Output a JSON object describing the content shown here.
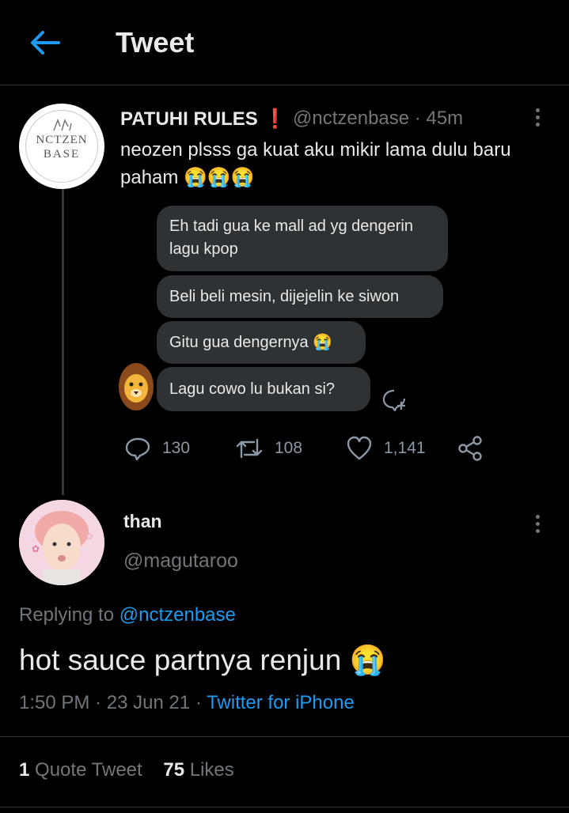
{
  "header": {
    "title": "Tweet",
    "back_icon": "arrow-left-icon",
    "accent": "#1d9bf0"
  },
  "tweet": {
    "author_name": "PATUHI RULES",
    "author_badge": "❗",
    "handle": "@nctzenbase",
    "dot": "·",
    "time": "45m",
    "text": "neozen plsss ga kuat aku mikir lama dulu baru paham 😭😭😭",
    "avatar_brand_line1": "NCTZEN",
    "avatar_brand_line2": "BASE",
    "image_chat": {
      "messages": [
        "Eh tadi gua ke mall ad yg dengerin lagu kpop",
        "Beli beli mesin, dijejelin ke siwon",
        "Gitu gua dengernya 😭",
        "Lagu cowo lu bukan si?"
      ],
      "add_reaction_icon": "add-reaction-icon"
    },
    "actions": {
      "replies": "130",
      "retweets": "108",
      "likes": "1,141"
    }
  },
  "reply": {
    "author_name": "than",
    "handle": "@magutaroo",
    "replying_label": "Replying to",
    "replying_handle": "@nctzenbase",
    "text": "hot sauce partnya renjun 😭",
    "time": "1:50 PM",
    "date": "23 Jun 21",
    "sep": "·",
    "source": "Twitter for iPhone",
    "quote_count": "1",
    "quote_label": "Quote Tweet",
    "likes_count": "75",
    "likes_label": "Likes"
  },
  "colors": {
    "background": "#000000",
    "text": "#e7e9ea",
    "muted": "#71767b",
    "link": "#1d9bf0",
    "bubble": "#2f3234"
  }
}
